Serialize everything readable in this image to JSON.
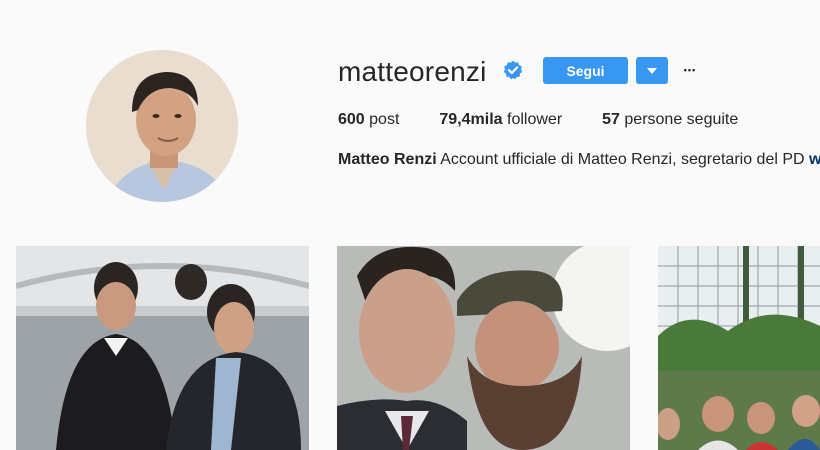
{
  "profile": {
    "username": "matteorenzi",
    "full_name": "Matteo Renzi",
    "bio_text": "Account ufficiale di Matteo Renzi, segretario del PD",
    "bio_link": "ww"
  },
  "actions": {
    "follow_label": "Segui",
    "dropdown_icon": "caret-down-icon",
    "more_icon": "ellipsis-icon",
    "more_glyph": "•••"
  },
  "stats": {
    "posts_value": "600",
    "posts_label": "post",
    "followers_value": "79,4mila",
    "followers_label": "follower",
    "following_value": "57",
    "following_label": "persone seguite"
  },
  "colors": {
    "accent": "#3897f0",
    "verified": "#3897f0",
    "background": "#fafafa"
  }
}
